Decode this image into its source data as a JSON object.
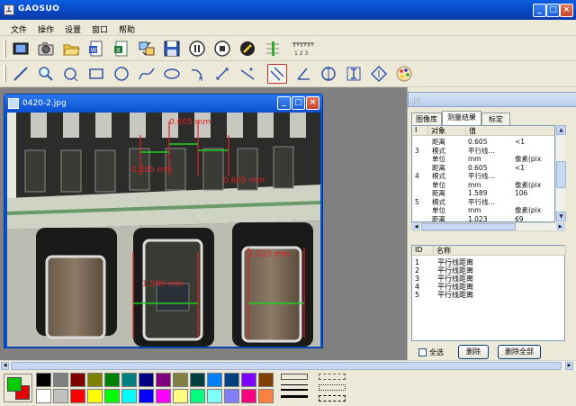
{
  "app": {
    "title": "GAOSUO",
    "icon": "ruler-app-icon"
  },
  "menubar": [
    "文件",
    "操作",
    "设置",
    "窗口",
    "帮助"
  ],
  "toolbar1": [
    "video-capture",
    "camera",
    "open-folder",
    "export-word",
    "export-excel",
    "transfer",
    "save",
    "play",
    "stop",
    "settings-wrench",
    "calibration",
    "ruler-scale"
  ],
  "toolbar2": [
    "line-tool",
    "zoom-tool",
    "circle-select",
    "rectangle",
    "circle",
    "curve",
    "ellipse",
    "arc",
    "angle-measure",
    "point-line",
    "parallel-lines",
    "angle-tool",
    "vertical-measure",
    "i-beam-measure",
    "diamond-measure",
    "palette"
  ],
  "ruler_icon_text": "1 2 3",
  "document": {
    "title": "0420-2.jpg",
    "measurements": [
      {
        "label": "0.605 mm",
        "color": "#e02020"
      },
      {
        "label": "0.585 mm",
        "color": "#e02020"
      },
      {
        "label": "0.605 mm",
        "color": "#e02020"
      },
      {
        "label": "1.023 mm",
        "color": "#e02020"
      },
      {
        "label": "1.589 mm",
        "color": "#e02020"
      }
    ]
  },
  "panel": {
    "title": "库",
    "tabs": [
      "图像库",
      "测量结果",
      "标定"
    ],
    "selected_tab": 1,
    "results": {
      "headers": [
        "I",
        "对象",
        "值"
      ],
      "rows": [
        [
          "",
          "距离",
          "0.605",
          "<1"
        ],
        [
          "3",
          "模式",
          "平行线...",
          ""
        ],
        [
          "",
          "单位",
          "mm",
          "像素(pix"
        ],
        [
          "",
          "距离",
          "0.605",
          "<1"
        ],
        [
          "4",
          "模式",
          "平行线...",
          ""
        ],
        [
          "",
          "单位",
          "mm",
          "像素(pix"
        ],
        [
          "",
          "距离",
          "1.589",
          "106"
        ],
        [
          "5",
          "模式",
          "平行线...",
          ""
        ],
        [
          "",
          "单位",
          "mm",
          "像素(pix"
        ],
        [
          "",
          "距离",
          "1.023",
          "69"
        ]
      ]
    },
    "list": {
      "headers": [
        "ID",
        "名称"
      ],
      "rows": [
        [
          "1",
          "平行线距离"
        ],
        [
          "2",
          "平行线距离"
        ],
        [
          "3",
          "平行线距离"
        ],
        [
          "4",
          "平行线距离"
        ],
        [
          "5",
          "平行线距离"
        ]
      ]
    },
    "select_all": "全选",
    "delete": "删除",
    "delete_all": "删除全部"
  },
  "palette": {
    "foreground": "#00cc00",
    "background": "#e00000",
    "row1": [
      "#000000",
      "#808080",
      "#800000",
      "#808000",
      "#008000",
      "#008080",
      "#000080",
      "#800080",
      "#808040",
      "#004040",
      "#0080ff",
      "#004080",
      "#8000ff",
      "#804000"
    ],
    "row2": [
      "#ffffff",
      "#c0c0c0",
      "#ff0000",
      "#ffff00",
      "#00ff00",
      "#00ffff",
      "#0000ff",
      "#ff00ff",
      "#ffff80",
      "#00ff80",
      "#80ffff",
      "#8080ff",
      "#ff0080",
      "#ff8040"
    ]
  }
}
